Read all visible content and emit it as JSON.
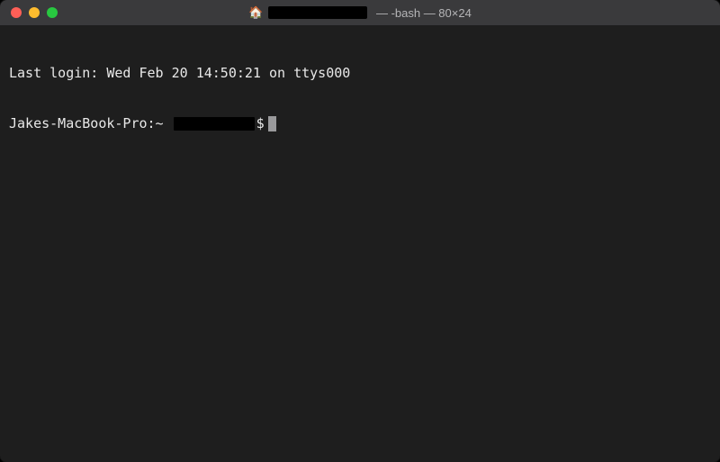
{
  "titlebar": {
    "icon": "🏠",
    "title_suffix": " — -bash — 80×24"
  },
  "terminal": {
    "last_login": "Last login: Wed Feb 20 14:50:21 on ttys000",
    "prompt_host": "Jakes-MacBook-Pro:~ ",
    "prompt_symbol": "$"
  }
}
